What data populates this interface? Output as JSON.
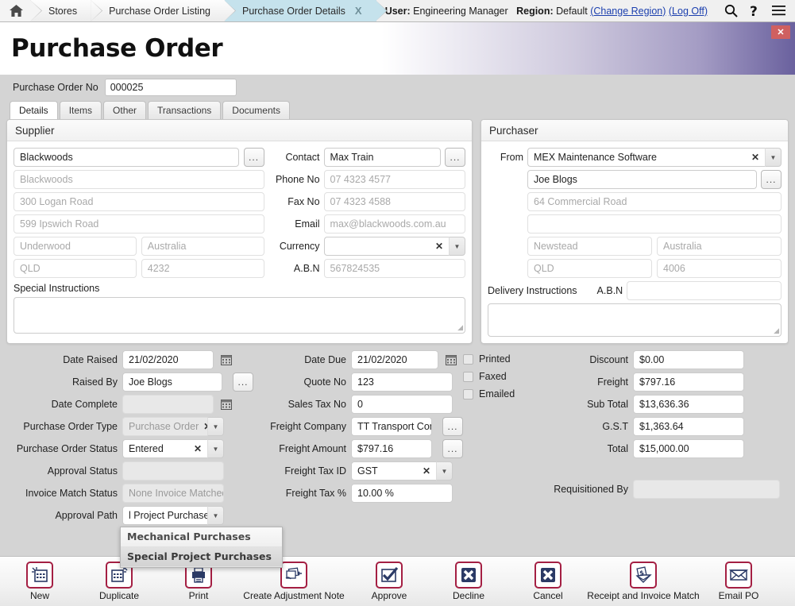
{
  "breadcrumb": {
    "home_icon": "home-icon",
    "items": [
      {
        "label": "Stores",
        "active": false
      },
      {
        "label": "Purchase Order Listing",
        "active": false
      },
      {
        "label": "Purchase Order Details",
        "active": true,
        "close": "X"
      }
    ]
  },
  "topbar": {
    "user_label": "User:",
    "user_value": "Engineering Manager",
    "region_label": "Region:",
    "region_value": "Default",
    "change_region": "(Change Region)",
    "log_off": "(Log Off)",
    "search_icon": "search-icon",
    "help_icon": "help-icon",
    "menu_icon": "hamburger-menu-icon"
  },
  "banner": {
    "title": "Purchase Order",
    "close_label": "✕"
  },
  "po_no": {
    "label": "Purchase Order No",
    "value": "000025"
  },
  "tabs": [
    {
      "label": "Details",
      "active": true
    },
    {
      "label": "Items",
      "active": false
    },
    {
      "label": "Other",
      "active": false
    },
    {
      "label": "Transactions",
      "active": false
    },
    {
      "label": "Documents",
      "active": false
    }
  ],
  "supplier": {
    "title": "Supplier",
    "name": "Blackwoods",
    "company": "Blackwoods",
    "address1": "300 Logan Road",
    "address2": "599 Ipswich Road",
    "city": "Underwood",
    "country": "Australia",
    "state": "QLD",
    "postcode": "4232",
    "contact_label": "Contact",
    "contact": "Max Train",
    "phone_label": "Phone No",
    "phone": "07 4323 4577",
    "fax_label": "Fax No",
    "fax": "07 4323 4588",
    "email_label": "Email",
    "email": "max@blackwoods.com.au",
    "currency_label": "Currency",
    "currency": "",
    "abn_label": "A.B.N",
    "abn": "567824535",
    "special_instructions_label": "Special Instructions",
    "special_instructions": "",
    "ellipsis": "..."
  },
  "purchaser": {
    "title": "Purchaser",
    "from_label": "From",
    "from": "MEX Maintenance Software",
    "person": "Joe Blogs",
    "address1": "64 Commercial Road",
    "address2": "",
    "city": "Newstead",
    "country": "Australia",
    "state": "QLD",
    "postcode": "4006",
    "delivery_instructions_label": "Delivery Instructions",
    "abn_label": "A.B.N",
    "abn": "",
    "delivery_instructions": "",
    "ellipsis": "..."
  },
  "details": {
    "date_raised_label": "Date Raised",
    "date_raised": "21/02/2020",
    "raised_by_label": "Raised By",
    "raised_by": "Joe Blogs",
    "date_complete_label": "Date Complete",
    "date_complete": "",
    "po_type_label": "Purchase Order Type",
    "po_type": "Purchase Order",
    "po_status_label": "Purchase Order Status",
    "po_status": "Entered",
    "approval_status_label": "Approval Status",
    "approval_status": "",
    "invoice_match_label": "Invoice Match Status",
    "invoice_match": "None Invoice Matched",
    "approval_path_label": "Approval Path",
    "approval_path": "l Project Purchases"
  },
  "freight": {
    "date_due_label": "Date Due",
    "date_due": "21/02/2020",
    "quote_no_label": "Quote No",
    "quote_no": "123",
    "sales_tax_no_label": "Sales Tax No",
    "sales_tax_no": "0",
    "freight_company_label": "Freight Company",
    "freight_company": "TT  Transport Company",
    "freight_amount_label": "Freight Amount",
    "freight_amount": "$797.16",
    "freight_tax_id_label": "Freight Tax ID",
    "freight_tax_id": "GST",
    "freight_tax_pct_label": "Freight Tax %",
    "freight_tax_pct": "10.00 %",
    "ellipsis": "..."
  },
  "flags": [
    {
      "label": "Printed",
      "checked": false
    },
    {
      "label": "Faxed",
      "checked": false
    },
    {
      "label": "Emailed",
      "checked": false
    }
  ],
  "totals": {
    "discount_label": "Discount",
    "discount": "$0.00",
    "freight_label": "Freight",
    "freight": "$797.16",
    "subtotal_label": "Sub Total",
    "subtotal": "$13,636.36",
    "gst_label": "G.S.T",
    "gst": "$1,363.64",
    "total_label": "Total",
    "total": "$15,000.00",
    "requisitioned_by_label": "Requisitioned By",
    "requisitioned_by": ""
  },
  "approval_dropdown": {
    "options": [
      {
        "label": "Mechanical Purchases",
        "selected": false
      },
      {
        "label": "Special Project Purchases",
        "selected": true
      }
    ]
  },
  "toolbar": [
    {
      "label": "New",
      "icon": "new-document-icon"
    },
    {
      "label": "Duplicate",
      "icon": "duplicate-icon"
    },
    {
      "label": "Print",
      "icon": "printer-icon"
    },
    {
      "label": "Create Adjustment Note",
      "icon": "adjustment-note-icon"
    },
    {
      "label": "Approve",
      "icon": "checkmark-icon"
    },
    {
      "label": "Decline",
      "icon": "cross-icon"
    },
    {
      "label": "Cancel",
      "icon": "cross-icon"
    },
    {
      "label": "Receipt and Invoice Match",
      "icon": "receipt-invoice-icon"
    },
    {
      "label": "Email PO",
      "icon": "envelope-icon"
    }
  ],
  "colors": {
    "accent_red": "#a41f43",
    "icon_navy": "#2b3a66",
    "close_red": "#cf6060",
    "active_crumb": "#c5e2ec",
    "link": "#1b3fae"
  }
}
